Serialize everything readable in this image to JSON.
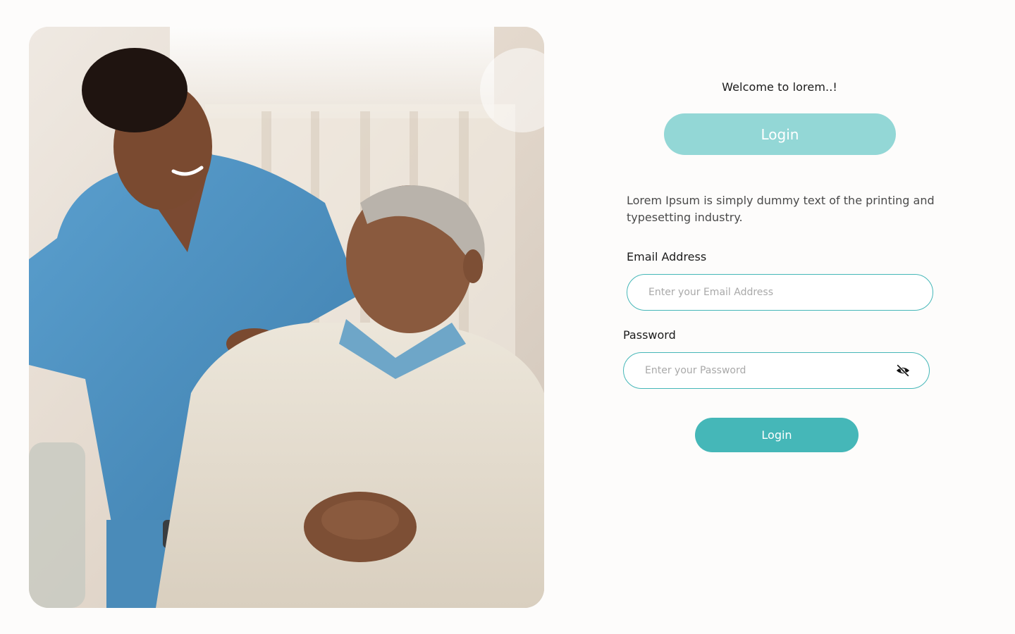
{
  "hero": {
    "image_description": "photo-nurse-with-elderly-man"
  },
  "form": {
    "welcome_text": "Welcome to lorem..!",
    "tab_label": "Login",
    "description": "Lorem Ipsum is simply dummy text of the printing and typesetting industry.",
    "email_label": "Email Address",
    "email_placeholder": "Enter your Email Address",
    "password_label": "Password",
    "password_placeholder": "Enter your Password",
    "submit_label": "Login"
  },
  "colors": {
    "accent": "#45b7b8",
    "accent_light": "#93d7d6",
    "background": "#fdfcfb"
  },
  "icons": {
    "password_toggle": "eye-off-icon"
  }
}
